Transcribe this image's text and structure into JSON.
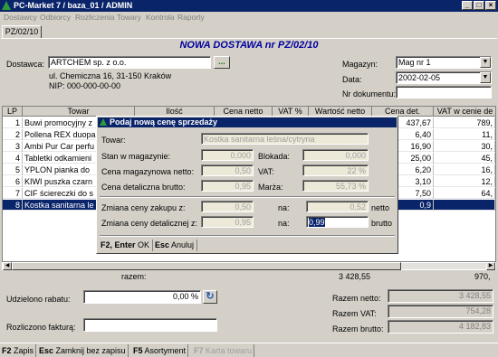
{
  "window": {
    "title": "PC-Market 7 / baza_01 / ADMIN",
    "buttons": [
      "_",
      "□",
      "×"
    ]
  },
  "menu": [
    "Dostawcy",
    "Odbiorcy",
    "Rozliczenia",
    "Towary",
    "Kontrola",
    "Raporty"
  ],
  "tab": "PZ/02/10",
  "header": {
    "title": "NOWA DOSTAWA nr PZ/02/10",
    "supplier_label": "Dostawca:",
    "supplier_name": "ARTCHEM sp. z o.o.",
    "supplier_address": "ul. Chemiczna 16, 31-150 Kraków",
    "supplier_nip": "NIP: 000-000-00-00",
    "more_button": "...",
    "warehouse_label": "Magazyn:",
    "warehouse_value": "Mag nr 1",
    "date_label": "Data:",
    "date_value": "2002-02-05",
    "docnum_label": "Nr dokumentu:",
    "docnum_value": ""
  },
  "grid": {
    "columns": [
      "LP",
      "Towar",
      "Ilość",
      "Cena netto",
      "VAT %",
      "Wartość netto",
      "Cena det.",
      "VAT w cenie de"
    ],
    "rows": [
      {
        "lp": "1",
        "name": "Buwi promocyjny z",
        "det": "437,67",
        "vat": "789,"
      },
      {
        "lp": "2",
        "name": "Pollena REX duopa",
        "det": "6,40",
        "vat": "11,"
      },
      {
        "lp": "3",
        "name": "Ambi Pur Car perfu",
        "det": "16,90",
        "vat": "30,"
      },
      {
        "lp": "4",
        "name": "Tabletki odkamieni",
        "det": "25,00",
        "vat": "45,"
      },
      {
        "lp": "5",
        "name": "YPLON pianka do",
        "det": "6,20",
        "vat": "16,"
      },
      {
        "lp": "6",
        "name": "KIWI puszka czarn",
        "det": "3,10",
        "vat": "12,"
      },
      {
        "lp": "7",
        "name": "CIF ściereczki do s",
        "det": "7,50",
        "vat": "64,"
      },
      {
        "lp": "8",
        "name": "Kostka sanitarna le",
        "det": "0,9",
        "vat": ""
      }
    ],
    "sum_label": "razem:",
    "sum_value": "3 428,55",
    "sum_vat": "970,"
  },
  "dialog": {
    "title": "Podaj nową cenę sprzedaży",
    "towar_label": "Towar:",
    "towar_value": "Kostka sanitarna leśna/cytryna",
    "stan_label": "Stan w magazynie:",
    "stan_value": "0,000",
    "blokada_label": "Blokada:",
    "blokada_value": "0,000",
    "cena_mag_label": "Cena magazynowa netto:",
    "cena_mag_value": "0,50",
    "vat_label": "VAT:",
    "vat_value": "22 %",
    "cena_det_label": "Cena detaliczna brutto:",
    "cena_det_value": "0,95",
    "marza_label": "Marża:",
    "marza_value": "55,73 %",
    "zmiana_zakupu_label": "Zmiana ceny zakupu z:",
    "zmiana_zakupu_from": "0,50",
    "na1_label": "na:",
    "zmiana_zakupu_to": "0,52",
    "netto_label": "netto",
    "zmiana_det_label": "Zmiana ceny detalicznej z:",
    "zmiana_det_from": "0,95",
    "na2_label": "na:",
    "zmiana_det_to": "0,99",
    "brutto_label": "brutto",
    "ok_key": "F2, Enter",
    "ok_label": "OK",
    "cancel_key": "Esc",
    "cancel_label": "Anuluj"
  },
  "footer_fields": {
    "rabat_label": "Udzielono rabatu:",
    "rabat_value": "0,00 %",
    "faktura_label": "Rozliczono fakturą:",
    "faktura_value": "",
    "razem_netto_label": "Razem netto:",
    "razem_netto_value": "3 428,55",
    "razem_vat_label": "Razem VAT:",
    "razem_vat_value": "754,28",
    "razem_brutto_label": "Razem brutto:",
    "razem_brutto_value": "4 182,83"
  },
  "fkeys": [
    {
      "key": "F2",
      "label": "Zapis"
    },
    {
      "key": "Esc",
      "label": "Zamknij bez zapisu"
    },
    {
      "key": "F5",
      "label": "Asortyment"
    },
    {
      "key": "F7",
      "label": "Karta towaru"
    }
  ]
}
